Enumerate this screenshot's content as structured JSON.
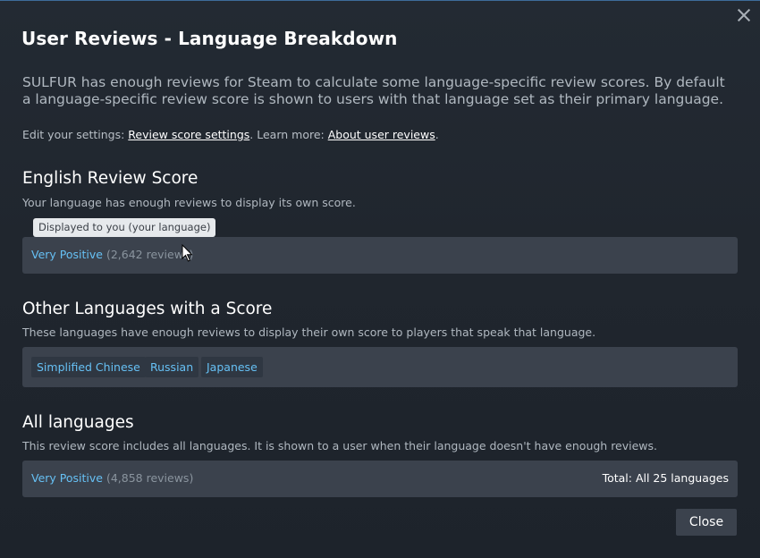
{
  "dialog": {
    "title": "User Reviews - Language Breakdown",
    "intro": "SULFUR has enough reviews for Steam to calculate some language-specific review scores. By default a language-specific review score is shown to users with that language set as their primary language.",
    "settings": {
      "prefix": "Edit your settings: ",
      "review_settings_link": "Review score settings",
      "middle": ". Learn more: ",
      "about_link": "About user reviews",
      "suffix": "."
    },
    "close_label": "Close"
  },
  "english": {
    "title": "English Review Score",
    "desc": "Your language has enough reviews to display its own score.",
    "tooltip": "Displayed to you (your language)",
    "score": "Very Positive",
    "count": "(2,642 reviews)"
  },
  "other_languages": {
    "title": "Other Languages with a Score",
    "desc": "These languages have enough reviews to display their own score to players that speak that language.",
    "languages": [
      "Simplified Chinese",
      "Russian",
      "Japanese"
    ]
  },
  "all_languages": {
    "title": "All languages",
    "desc": "This review score includes all languages. It is shown to a user when their language doesn't have enough reviews.",
    "score": "Very Positive",
    "count": "(4,858 reviews)",
    "total": "Total: All 25 languages"
  },
  "colors": {
    "accent_blue": "#66c0f4",
    "panel": "#3b424d",
    "background": "#20262e"
  }
}
